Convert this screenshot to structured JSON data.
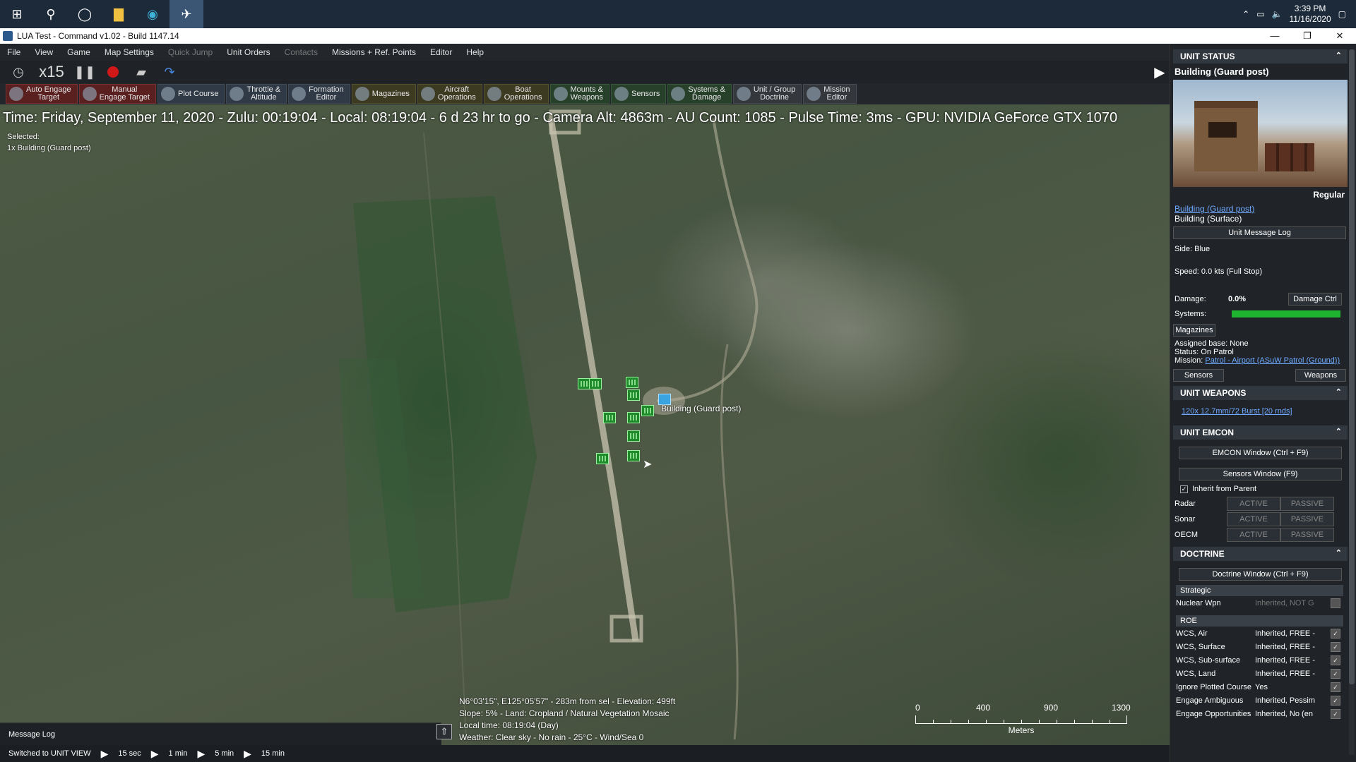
{
  "taskbar": {
    "clock_time": "3:39 PM",
    "clock_date": "11/16/2020"
  },
  "window": {
    "title": "LUA Test - Command v1.02 - Build 1147.14",
    "minimize": "—",
    "maximize": "❐",
    "close": "✕"
  },
  "menu": [
    {
      "label": "File",
      "disabled": false
    },
    {
      "label": "View",
      "disabled": false
    },
    {
      "label": "Game",
      "disabled": false
    },
    {
      "label": "Map Settings",
      "disabled": false
    },
    {
      "label": "Quick Jump",
      "disabled": true
    },
    {
      "label": "Unit Orders",
      "disabled": false
    },
    {
      "label": "Contacts",
      "disabled": true
    },
    {
      "label": "Missions + Ref. Points",
      "disabled": false
    },
    {
      "label": "Editor",
      "disabled": false
    },
    {
      "label": "Help",
      "disabled": false
    }
  ],
  "controls": {
    "speed": "x15"
  },
  "toolbar": [
    {
      "label1": "Auto Engage",
      "label2": "Target",
      "style": "red",
      "icon": "target-icon"
    },
    {
      "label1": "Manual",
      "label2": "Engage Target",
      "style": "red",
      "icon": "crosshair-icon"
    },
    {
      "label1": "Plot Course",
      "label2": "",
      "style": "",
      "icon": "compass-icon"
    },
    {
      "label1": "Throttle &",
      "label2": "Altitude",
      "style": "",
      "icon": "throttle-icon"
    },
    {
      "label1": "Formation",
      "label2": "Editor",
      "style": "",
      "icon": "formation-icon"
    },
    {
      "label1": "Magazines",
      "label2": "",
      "style": "olive",
      "icon": "magazine-icon"
    },
    {
      "label1": "Aircraft",
      "label2": "Operations",
      "style": "olive",
      "icon": "aircraft-icon"
    },
    {
      "label1": "Boat",
      "label2": "Operations",
      "style": "olive",
      "icon": "boat-icon"
    },
    {
      "label1": "Mounts &",
      "label2": "Weapons",
      "style": "green",
      "icon": "weapons-icon"
    },
    {
      "label1": "Sensors",
      "label2": "",
      "style": "green",
      "icon": "sensor-icon"
    },
    {
      "label1": "Systems &",
      "label2": "Damage",
      "style": "green",
      "icon": "gear-icon"
    },
    {
      "label1": "Unit / Group",
      "label2": "Doctrine",
      "style": "grey",
      "icon": "doctrine-icon"
    },
    {
      "label1": "Mission",
      "label2": "Editor",
      "style": "grey",
      "icon": "mission-icon"
    }
  ],
  "map": {
    "status_line": "Time: Friday, September 11, 2020 - Zulu: 00:19:04 - Local: 08:19:04 - 6 d 23 hr to go  -  Camera Alt: 4863m  - AU Count: 1085 - Pulse Time: 3ms - GPU: NVIDIA GeForce GTX 1070",
    "selected_label": "Selected:",
    "selected_value": "1x Building (Guard post)",
    "unit_label": "Building (Guard post)",
    "coord_line1": "N6°03'15\", E125°05'57\" - 283m from sel - Elevation: 499ft",
    "coord_line2": "Slope: 5%  - Land: Cropland / Natural Vegetation Mosaic",
    "coord_line3": "Local time: 08:19:04 (Day)",
    "coord_line4": "Weather: Clear sky - No rain - 25°C - Wind/Sea 0",
    "scale_labels": [
      "0",
      "400",
      "900",
      "1300"
    ],
    "scale_unit": "Meters"
  },
  "message_log": {
    "label": "Message Log"
  },
  "bottom": {
    "status": "Switched to UNIT VIEW",
    "steps": [
      "15 sec",
      "1 min",
      "5 min",
      "15 min"
    ]
  },
  "unit_status": {
    "header": "UNIT STATUS",
    "name": "Building (Guard post)",
    "proficiency": "Regular",
    "link_name": "Building (Guard post)",
    "type": "Building (Surface)",
    "message_log_btn": "Unit Message Log",
    "side": "Side: Blue",
    "speed": "Speed: 0.0 kts (Full Stop)",
    "damage_label": "Damage:",
    "damage_value": "0.0%",
    "damage_ctrl_btn": "Damage Ctrl",
    "systems_label": "Systems:",
    "systems_health": 1.0,
    "magazines_btn": "Magazines",
    "assigned_base": "Assigned base: None",
    "status": "Status: On Patrol",
    "mission_label": "Mission:",
    "mission_value": "Patrol - Airport (ASuW Patrol (Ground))",
    "sensors_btn": "Sensors",
    "weapons_btn": "Weapons"
  },
  "unit_weapons": {
    "header": "UNIT WEAPONS",
    "entry": "120x 12.7mm/72 Burst [20 rnds]"
  },
  "unit_emcon": {
    "header": "UNIT EMCON",
    "emcon_btn": "EMCON Window (Ctrl + F9)",
    "sensors_btn": "Sensors Window (F9)",
    "inherit_label": "Inherit from Parent",
    "rows": [
      {
        "name": "Radar",
        "active": "ACTIVE",
        "passive": "PASSIVE"
      },
      {
        "name": "Sonar",
        "active": "ACTIVE",
        "passive": "PASSIVE"
      },
      {
        "name": "OECM",
        "active": "ACTIVE",
        "passive": "PASSIVE"
      }
    ]
  },
  "doctrine": {
    "header": "DOCTRINE",
    "window_btn": "Doctrine Window (Ctrl + F9)",
    "strategic_label": "Strategic",
    "nuclear_key": "Nuclear Wpn",
    "nuclear_value": "Inherited, NOT G",
    "roe_label": "ROE",
    "rows": [
      {
        "k": "WCS, Air",
        "v": "Inherited, FREE -"
      },
      {
        "k": "WCS, Surface",
        "v": "Inherited, FREE -"
      },
      {
        "k": "WCS, Sub-surface",
        "v": "Inherited, FREE -"
      },
      {
        "k": "WCS, Land",
        "v": "Inherited, FREE -"
      },
      {
        "k": "Ignore Plotted Course",
        "v": "Yes"
      },
      {
        "k": "Engage Ambiguous",
        "v": "Inherited, Pessim"
      },
      {
        "k": "Engage Opportunities",
        "v": "Inherited, No (en"
      }
    ]
  }
}
